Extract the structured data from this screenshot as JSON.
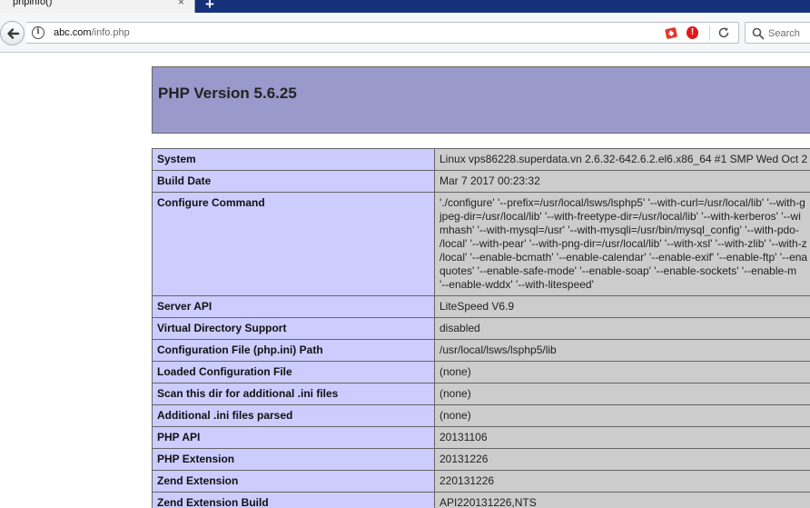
{
  "browser": {
    "tab": {
      "title": "phpinfo()",
      "close_icon": "×",
      "newtab_icon": "+"
    },
    "url": {
      "host": "abc.com",
      "path": "/info.php"
    },
    "search": {
      "placeholder": "Search"
    },
    "icons": [
      "back-arrow-icon",
      "info-icon",
      "addon-icon",
      "block-icon",
      "reload-icon",
      "search-icon"
    ]
  },
  "page": {
    "title": "PHP Version 5.6.25",
    "rows": [
      {
        "label": "System",
        "value": "Linux vps86228.superdata.vn 2.6.32-642.6.2.el6.x86_64 #1 SMP Wed Oct 2"
      },
      {
        "label": "Build Date",
        "value": "Mar 7 2017 00:23:32"
      },
      {
        "label": "Configure Command",
        "value_lines": [
          "'./configure' '--prefix=/usr/local/lsws/lsphp5' '--with-curl=/usr/local/lib' '--with-g",
          "jpeg-dir=/usr/local/lib' '--with-freetype-dir=/usr/local/lib' '--with-kerberos' '--wi",
          "mhash' '--with-mysql=/usr' '--with-mysqli=/usr/bin/mysql_config' '--with-pdo-",
          "/local' '--with-pear' '--with-png-dir=/usr/local/lib' '--with-xsl' '--with-zlib' '--with-z",
          "/local' '--enable-bcmath' '--enable-calendar' '--enable-exif' '--enable-ftp' '--ena",
          "quotes' '--enable-safe-mode' '--enable-soap' '--enable-sockets' '--enable-m",
          "'--enable-wddx' '--with-litespeed'"
        ]
      },
      {
        "label": "Server API",
        "value": "LiteSpeed V6.9"
      },
      {
        "label": "Virtual Directory Support",
        "value": "disabled"
      },
      {
        "label": "Configuration File (php.ini) Path",
        "value": "/usr/local/lsws/lsphp5/lib"
      },
      {
        "label": "Loaded Configuration File",
        "value": "(none)"
      },
      {
        "label": "Scan this dir for additional .ini files",
        "value": "(none)"
      },
      {
        "label": "Additional .ini files parsed",
        "value": "(none)"
      },
      {
        "label": "PHP API",
        "value": "20131106"
      },
      {
        "label": "PHP Extension",
        "value": "20131226"
      },
      {
        "label": "Zend Extension",
        "value": "220131226"
      },
      {
        "label": "Zend Extension Build",
        "value": "API220131226,NTS"
      }
    ]
  },
  "colors": {
    "header_bg": "#9999cc",
    "label_bg": "#ccccff",
    "value_bg": "#cccccc",
    "tabstrip_bg": "#14317a"
  }
}
